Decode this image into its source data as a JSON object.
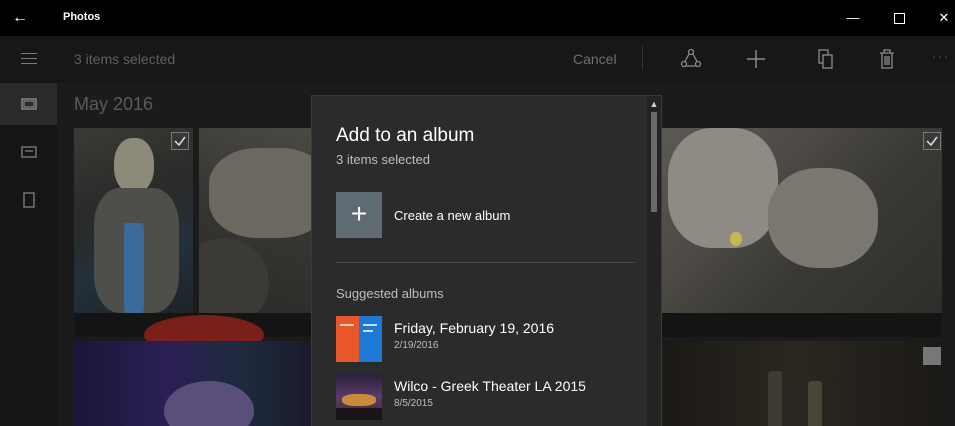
{
  "window": {
    "title": "Photos",
    "back_icon": "back-arrow-icon",
    "minimize_glyph": "—",
    "close_glyph": "✕"
  },
  "command_bar": {
    "selected_count": "3 items selected",
    "cancel_label": "Cancel",
    "icons": [
      "share-icon",
      "add-icon",
      "copy-icon",
      "delete-icon"
    ],
    "more_glyph": "···"
  },
  "nav_rail": {
    "items": [
      {
        "icon": "collection-icon",
        "active": true
      },
      {
        "icon": "albums-icon",
        "active": false
      },
      {
        "icon": "folders-icon",
        "active": false
      }
    ]
  },
  "content": {
    "section_title": "May 2016"
  },
  "dialog": {
    "title": "Add to an album",
    "subtitle": "3 items selected",
    "create_new_label": "Create a new album",
    "create_new_glyph": "+",
    "suggested_header": "Suggested albums",
    "albums": [
      {
        "name": "Friday, February 19, 2016",
        "date": "2/19/2016"
      },
      {
        "name": "Wilco - Greek Theater LA 2015",
        "date": "8/5/2015"
      }
    ],
    "scroll_up_glyph": "▲"
  },
  "colors": {
    "titlebar": "#000000",
    "command_bar": "#171717",
    "dialog_bg": "#2b2b2b",
    "new_album_tile": "#5f6b73",
    "accent_orange": "#e8572a",
    "accent_blue": "#1e78d6"
  }
}
